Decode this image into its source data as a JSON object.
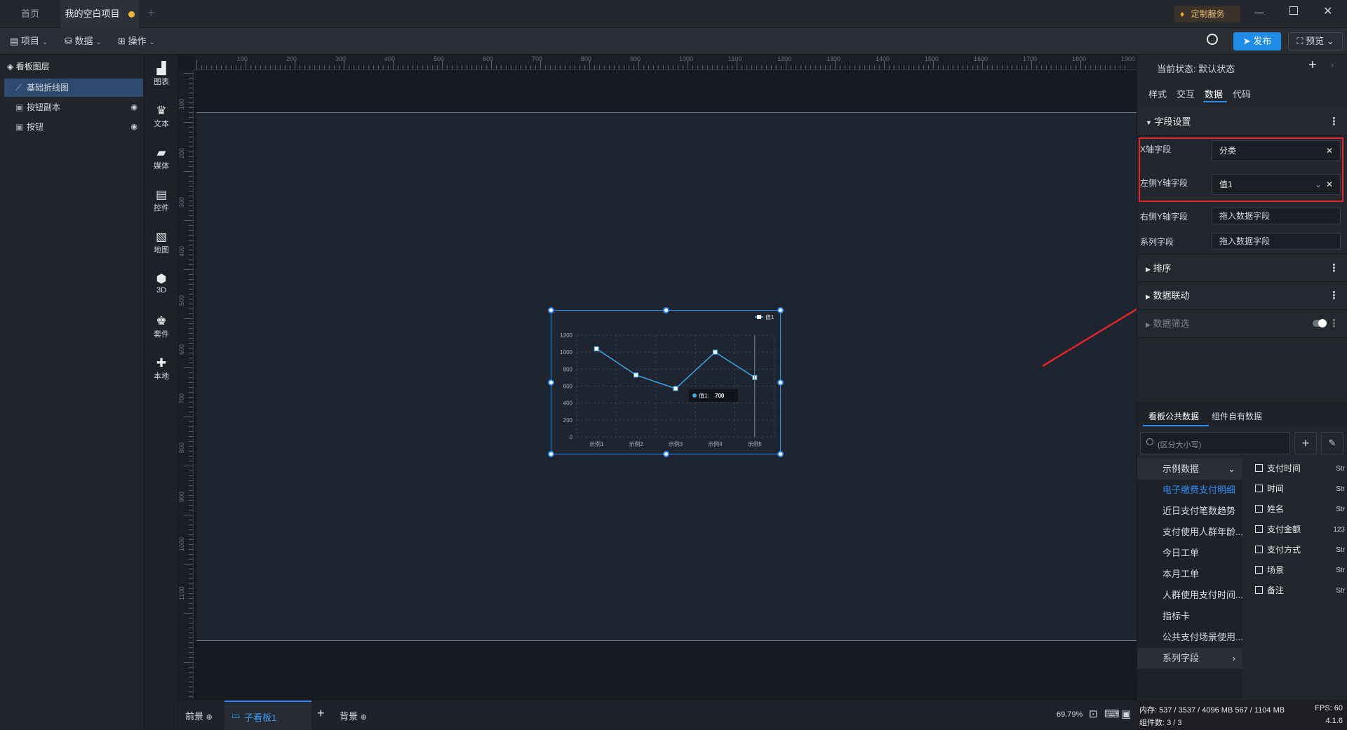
{
  "tabs": [
    {
      "label": "首页"
    },
    {
      "label": "我的空白项目"
    }
  ],
  "titlebar": {
    "custom_service": "定制服务"
  },
  "menubar": {
    "project": "项目",
    "data": "数据",
    "operation": "操作",
    "publish": "发布",
    "preview": "预览"
  },
  "layers": {
    "title": "看板图层",
    "items": [
      {
        "label": "基础折线图"
      },
      {
        "label": "按钮副本"
      },
      {
        "label": "按钮"
      }
    ]
  },
  "toolbox": {
    "items": [
      {
        "label": "图表"
      },
      {
        "label": "文本"
      },
      {
        "label": "媒体"
      },
      {
        "label": "控件"
      },
      {
        "label": "地图"
      },
      {
        "label": "3D"
      },
      {
        "label": "套件"
      },
      {
        "label": "本地"
      }
    ]
  },
  "ruler": {
    "h_ticks": [
      "100",
      "200",
      "300",
      "400",
      "500",
      "600",
      "700",
      "800",
      "900",
      "1000",
      "1100",
      "1200",
      "1300",
      "1400",
      "1500",
      "1600",
      "1700",
      "1800",
      "1900"
    ],
    "v_ticks": [
      "100",
      "200",
      "300",
      "400",
      "500",
      "600",
      "700",
      "800",
      "900",
      "1000",
      "1100"
    ]
  },
  "chart_data": {
    "type": "line",
    "categories": [
      "示例1",
      "示例2",
      "示例3",
      "示例4",
      "示例5"
    ],
    "series": [
      {
        "name": "值1",
        "values": [
          1040,
          730,
          570,
          1000,
          700
        ]
      }
    ],
    "ylim": [
      0,
      1200
    ],
    "yticks": [
      "0",
      "200",
      "400",
      "600",
      "800",
      "1000",
      "1200"
    ],
    "tooltip": {
      "label": "值1:",
      "value": "700"
    },
    "legend": "top-right",
    "grid": true,
    "colors": {
      "line": "#3aa8e8"
    }
  },
  "bottombar": {
    "front": "前景",
    "sub_board": "子看板1",
    "background": "背景",
    "zoom": "69.79%"
  },
  "rightpanel": {
    "state_label": "当前状态:",
    "state_value": "默认状态",
    "tabs": [
      {
        "label": "样式"
      },
      {
        "label": "交互"
      },
      {
        "label": "数据"
      },
      {
        "label": "代码"
      }
    ],
    "field_settings": {
      "title": "字段设置",
      "x_axis": {
        "label": "X轴字段",
        "value": "分类"
      },
      "left_y": {
        "label": "左侧Y轴字段",
        "value": "值1"
      },
      "right_y": {
        "label": "右侧Y轴字段",
        "placeholder": "拖入数据字段"
      },
      "series": {
        "label": "系列字段",
        "placeholder": "拖入数据字段"
      }
    },
    "sections": {
      "sort": "排序",
      "linkage": "数据联动",
      "filter": "数据筛选"
    },
    "data_tabs": [
      {
        "label": "看板公共数据"
      },
      {
        "label": "组件自有数据"
      }
    ],
    "search_placeholder": "(区分大小写)",
    "datasets": {
      "group": "示例数据",
      "items": [
        "电子缴费支付明细",
        "近日支付笔数趋势",
        "支付使用人群年龄...",
        "今日工单",
        "本月工单",
        "人群使用支付时间...",
        "指标卡",
        "公共支付场景使用..."
      ],
      "series_group": "系列字段"
    },
    "fields": [
      {
        "name": "支付时间",
        "type": "Str"
      },
      {
        "name": "时间",
        "type": "Str"
      },
      {
        "name": "姓名",
        "type": "Str"
      },
      {
        "name": "支付金额",
        "type": "123"
      },
      {
        "name": "支付方式",
        "type": "Str"
      },
      {
        "name": "场景",
        "type": "Str"
      },
      {
        "name": "备注",
        "type": "Str"
      }
    ]
  },
  "status": {
    "memory": "内存:  537 / 3537 / 4096 MB  567 / 1104 MB",
    "fps": "FPS:  60",
    "components": "组件数: 3 / 3",
    "version": "4.1.6"
  }
}
